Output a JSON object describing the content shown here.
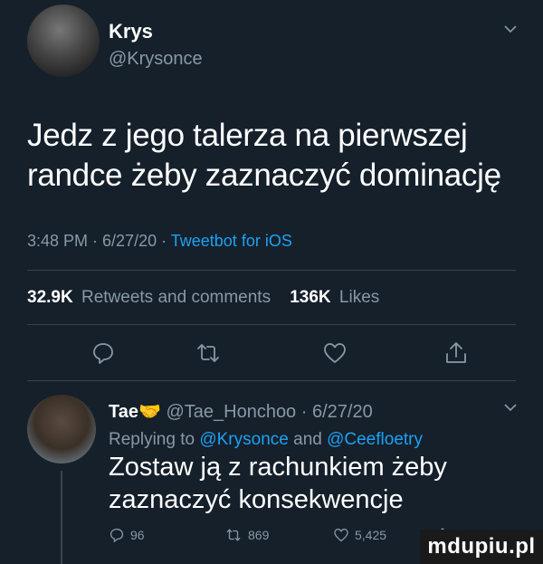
{
  "tweet": {
    "author_name": "Krys",
    "author_handle": "@Krysonce",
    "text": "Jedz z jego talerza na pierwszej randce żeby zaznaczyć dominację",
    "time": "3:48 PM · 6/27/20 · ",
    "client": "Tweetbot for iOS",
    "retweets_count": "32.9K",
    "retweets_label": "Retweets and comments",
    "likes_count": "136K",
    "likes_label": "Likes"
  },
  "reply": {
    "author_name": "Tae",
    "author_emoji": "🤝",
    "meta": "@Tae_Honchoo · 6/27/20",
    "replying_prefix": "Replying to ",
    "mention1": "@Krysonce",
    "and_word": " and ",
    "mention2": "@Ceefloetry",
    "text": "Zostaw ją z rachunkiem żeby zaznaczyć konsekwencje",
    "reply_count": "96",
    "retweet_count": "869",
    "like_count": "5,425"
  },
  "watermark": "mdupiu.pl",
  "colors": {
    "background": "#15202b",
    "secondary_text": "#8899a6",
    "link": "#1da1f2",
    "divider": "#38444d"
  },
  "icons": [
    "chevron-down-icon",
    "reply-icon",
    "retweet-icon",
    "like-icon",
    "share-icon"
  ]
}
